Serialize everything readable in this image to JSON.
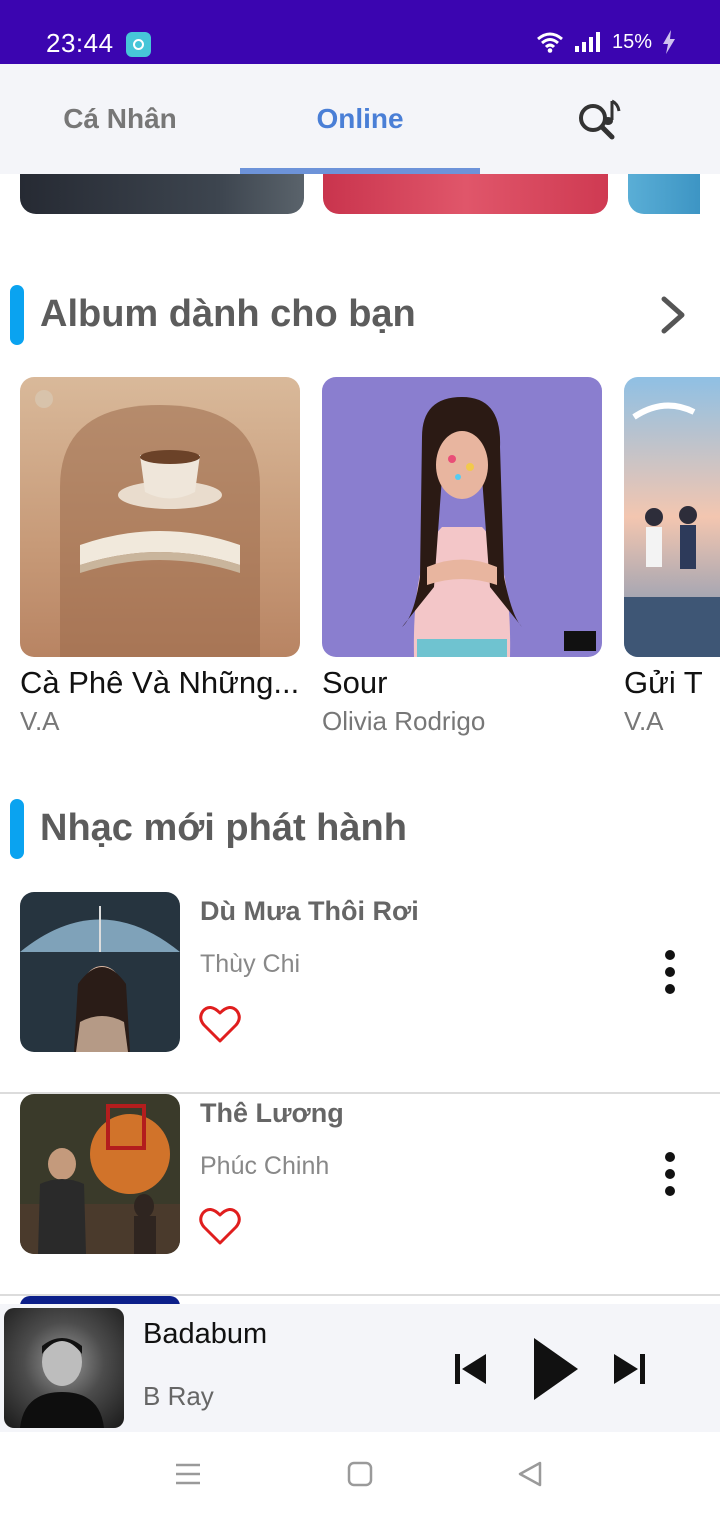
{
  "status_bar": {
    "time": "23:44",
    "battery": "15%"
  },
  "tabs": [
    {
      "label": "Cá Nhân"
    },
    {
      "label": "Online"
    }
  ],
  "sections": {
    "albums": {
      "title": "Album dành cho bạn",
      "items": [
        {
          "title": "Cà Phê Và Những...",
          "artist": "V.A"
        },
        {
          "title": "Sour",
          "artist": "Olivia Rodrigo"
        },
        {
          "title": "Gửi T",
          "artist": "V.A"
        }
      ]
    },
    "new_releases": {
      "title": "Nhạc mới phát hành",
      "items": [
        {
          "title": "Dù Mưa Thôi Rơi",
          "artist": "Thùy Chi"
        },
        {
          "title": "Thê Lương",
          "artist": "Phúc Chinh"
        }
      ]
    }
  },
  "player": {
    "title": "Badabum",
    "artist": "B Ray"
  },
  "colors": {
    "status_bar": "#3b05b0",
    "accent": "#4a7fd6",
    "section_bar": "#0aa3f0",
    "heart": "#e01e1e"
  }
}
